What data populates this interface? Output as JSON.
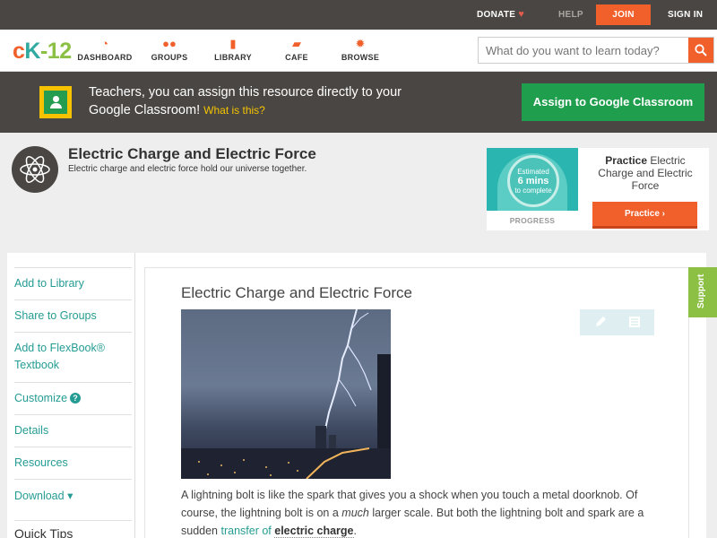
{
  "topbar": {
    "donate": "DONATE",
    "help": "HELP",
    "join": "JOIN",
    "signin": "SIGN IN"
  },
  "logo": {
    "c": "c",
    "k": "K",
    "n": "-12"
  },
  "nav": [
    {
      "label": "DASHBOARD",
      "icon": "dashboard-icon"
    },
    {
      "label": "GROUPS",
      "icon": "groups-icon"
    },
    {
      "label": "LIBRARY",
      "icon": "library-icon"
    },
    {
      "label": "CAFE",
      "icon": "cafe-icon"
    },
    {
      "label": "BROWSE",
      "icon": "browse-icon"
    }
  ],
  "search": {
    "placeholder": "What do you want to learn today?"
  },
  "google_banner": {
    "text": "Teachers, you can assign this resource directly to your Google Classroom!",
    "what": "What is this?",
    "button": "Assign to Google Classroom"
  },
  "concept": {
    "title": "Electric Charge and Electric Force",
    "subtitle": "Electric charge and electric force hold our universe together."
  },
  "practice": {
    "estimated": "Estimated",
    "mins": "6 mins",
    "to_complete": "to complete",
    "progress_label": "PROGRESS",
    "title_bold": "Practice",
    "title_rest": " Electric Charge and Electric Force",
    "button": "Practice"
  },
  "sidebar": {
    "items": [
      "Add to Library",
      "Share to Groups",
      "Add to FlexBook® Textbook",
      "Customize",
      "Details",
      "Resources",
      "Download ▾"
    ],
    "customize_help": "?",
    "quick_tips": "Quick Tips"
  },
  "article": {
    "title": "Electric Charge and Electric Force",
    "p1": "A lightning bolt is like the spark that gives you a shock when you touch a metal doorknob. Of course, the lightning bolt is on a ",
    "p1_em": "much",
    "p1_b": " larger scale. But both the lightning bolt and spark are a sudden ",
    "link": "transfer of",
    "term": "electric charge",
    "end": "."
  },
  "support": "Support",
  "colors": {
    "accent": "#f15f2a",
    "teal": "#259c93",
    "green": "#1f9e4d",
    "dark": "#4a4643"
  }
}
